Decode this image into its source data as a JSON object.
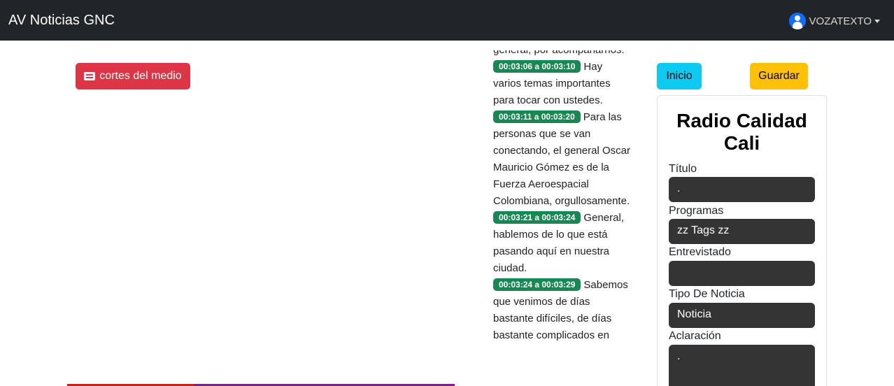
{
  "app": {
    "brand": "AV Noticias GNC",
    "user": "VOZATEXTO"
  },
  "left": {
    "cortes_button": "cortes del medio"
  },
  "transcript": {
    "lead_in": "general, por acompañarnos.",
    "segments": [
      {
        "stamp": "00:03:06 a 00:03:10",
        "text": "Hay varios temas importantes para tocar con ustedes."
      },
      {
        "stamp": "00:03:11 a 00:03:20",
        "text": "Para las personas que se van conectando, el general Oscar Mauricio Gómez es de la Fuerza Aeroespacial Colombiana, orgullosamente."
      },
      {
        "stamp": "00:03:21 a 00:03:24",
        "text": "General, hablemos de lo que está pasando aquí en nuestra ciudad."
      },
      {
        "stamp": "00:03:24 a 00:03:29",
        "text": "Sabemos que venimos de días bastante difíciles, de días bastante complicados en"
      }
    ]
  },
  "actions": {
    "inicio": "Inicio",
    "guardar": "Guardar"
  },
  "form": {
    "station": "Radio Calidad Cali",
    "titulo_label": "Título",
    "titulo_value": ".",
    "programas_label": "Programas",
    "programas_value": "zz Tags zz",
    "entrevistado_label": "Entrevistado",
    "entrevistado_value": "",
    "tipo_label": "Tipo De Noticia",
    "tipo_value": "Noticia",
    "aclaracion_label": "Aclaración",
    "aclaracion_value": "."
  },
  "colors": {
    "navbar": "#212529",
    "danger": "#dc3545",
    "success": "#198754",
    "info": "#0dcaf0",
    "warning": "#ffc107",
    "field_bg": "#343434"
  }
}
